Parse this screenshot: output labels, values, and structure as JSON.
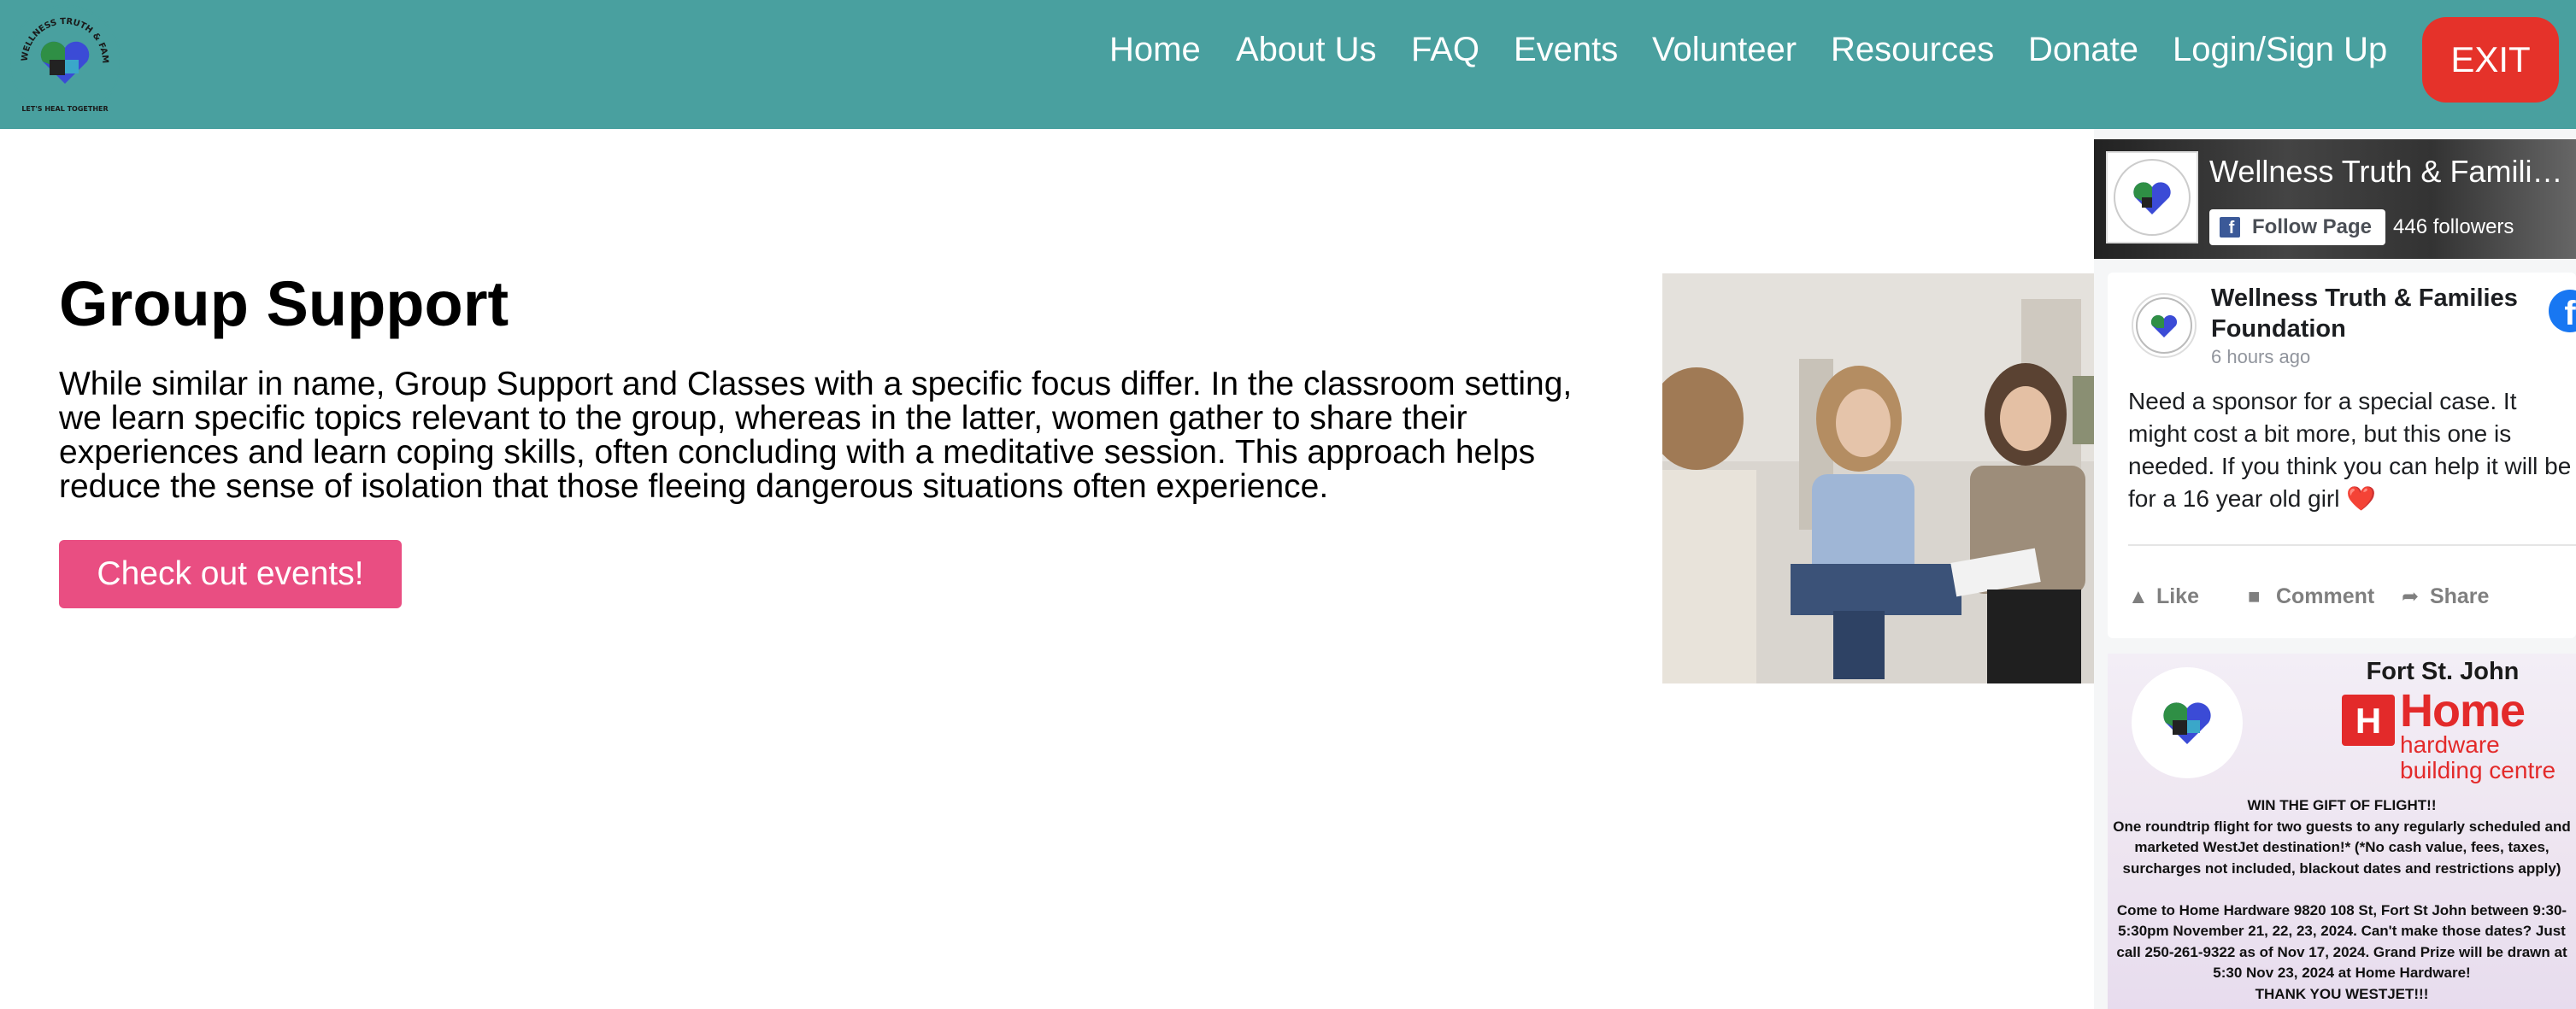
{
  "header": {
    "logo_alt": "Wellness Truth & Family Foundation logo",
    "logo_ring_text": "WELLNESS TRUTH & FAMILY FOUNDATION",
    "logo_tagline": "LET'S HEAL TOGETHER",
    "nav": [
      "Home",
      "About Us",
      "FAQ",
      "Events",
      "Volunteer",
      "Resources",
      "Donate",
      "Login/Sign Up"
    ],
    "exit_label": "EXIT",
    "bg_color": "#49a09f",
    "exit_color": "#e5322a"
  },
  "main": {
    "title": "Group Support",
    "description": "While similar in name, Group Support and Classes with a specific focus differ. In the classroom setting, we learn specific topics relevant to the group, whereas in the latter, women gather to share their experiences and learn coping skills, often concluding with a meditative session. This approach helps reduce the sense of isolation that those fleeing dangerous situations often experience.",
    "cta_label": "Check out events!",
    "cta_color": "#e94e82",
    "photo_alt": "Three people sitting in a group support session"
  },
  "facebook": {
    "page_name": "Wellness Truth & Families Foundation",
    "follow_label": "Follow Page",
    "followers": "446 followers",
    "post": {
      "author": "Wellness Truth & Families Foundation",
      "time": "6 hours ago",
      "text": "Need a sponsor for a special case. It might cost a bit more, but this one is needed. If you think you can help it will be for a 16 year old girl ❤️",
      "actions": [
        "Like",
        "Comment",
        "Share"
      ]
    },
    "flyer": {
      "city": "Fort St. John",
      "brand_main": "Home",
      "brand_sub1": "hardware",
      "brand_sub2": "building centre",
      "text": "WIN THE GIFT OF FLIGHT!!\nOne roundtrip flight for two guests to any regularly scheduled and marketed WestJet destination!* (*No cash value, fees, taxes, surcharges not included, blackout dates and restrictions apply)\n\nCome to Home Hardware 9820 108 St, Fort St John between 9:30-5:30pm November 21, 22, 23, 2024. Can't make those dates? Just call 250-261-9322 as of Nov 17, 2024. Grand Prize will be drawn at  5:30 Nov 23, 2024 at Home Hardware!\nTHANK YOU WESTJET!!!"
    }
  }
}
